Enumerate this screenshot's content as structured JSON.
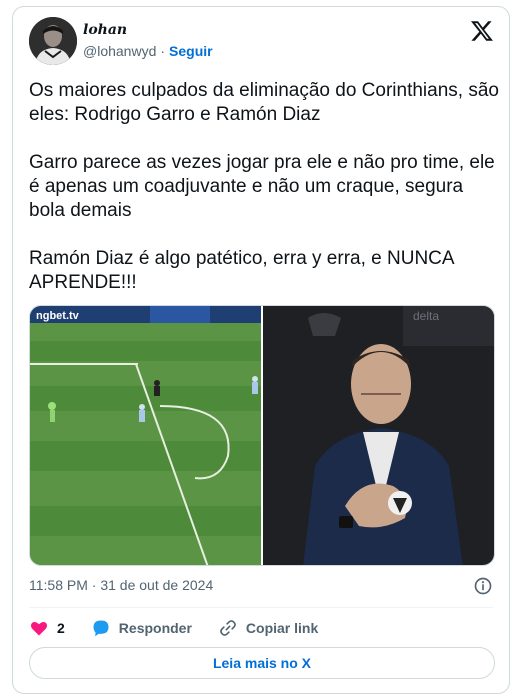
{
  "author": {
    "display_name": "lohan",
    "handle": "@lohanwyd",
    "follow_label": "Seguir"
  },
  "tweet": {
    "paragraphs": [
      "Os maiores culpados da eliminação do Corinthians, são eles: Rodrigo Garro e Ramón Diaz",
      "Garro parece as vezes jogar pra ele e não pro time, ele é apenas um coadjuvante e não um craque, segura bola demais",
      "Ramón Diaz é algo patético, erra y erra, e NUNCA APRENDE!!!"
    ]
  },
  "media": {
    "left_board_text": "ngbet.tv",
    "right_board_text": "delta"
  },
  "meta": {
    "time": "11:58 PM",
    "separator": "·",
    "date": "31 de out de 2024"
  },
  "actions": {
    "likes_count": "2",
    "reply_label": "Responder",
    "copy_label": "Copiar link"
  },
  "read_more_label": "Leia mais no X",
  "colors": {
    "link": "#006fd6",
    "like": "#f91880",
    "reply": "#1d9bf0",
    "muted": "#536471",
    "border": "#cfd9de"
  }
}
